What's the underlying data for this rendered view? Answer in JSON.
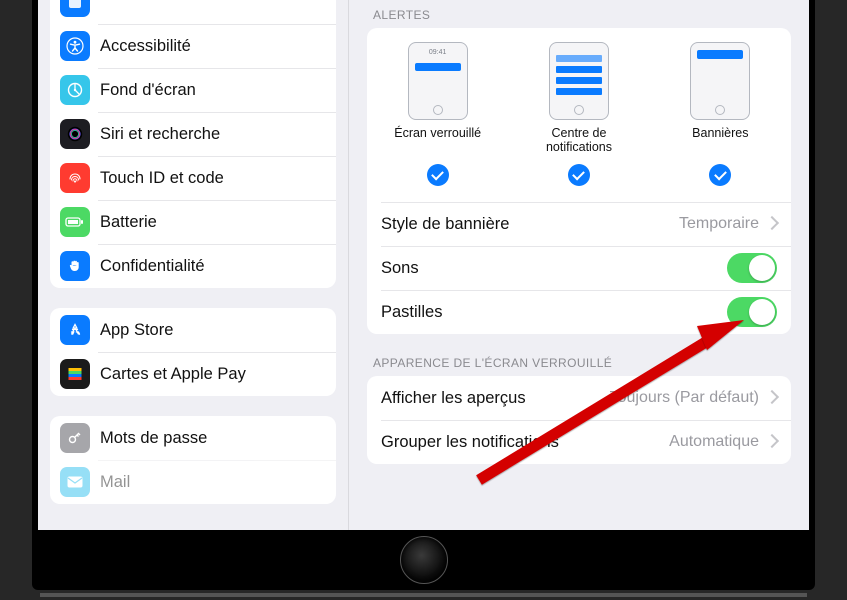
{
  "sidebar": {
    "group1": [
      {
        "label": "",
        "bg": "#0a7bff"
      },
      {
        "label": "Accessibilité",
        "bg": "#0a7bff",
        "icon": "accessibility"
      },
      {
        "label": "Fond d'écran",
        "bg": "#36c6ea",
        "icon": "wallpaper"
      },
      {
        "label": "Siri et recherche",
        "bg": "#2f2f35",
        "icon": "siri"
      },
      {
        "label": "Touch ID et code",
        "bg": "#ff3b30",
        "icon": "fingerprint"
      },
      {
        "label": "Batterie",
        "bg": "#4cd964",
        "icon": "battery"
      },
      {
        "label": "Confidentialité",
        "bg": "#0a7bff",
        "icon": "hand"
      }
    ],
    "group2": [
      {
        "label": "App Store",
        "bg": "#0a7bff",
        "icon": "appstore"
      },
      {
        "label": "Cartes et Apple Pay",
        "bg": "#1b1b1b",
        "icon": "wallet"
      }
    ],
    "group3": [
      {
        "label": "Mots de passe",
        "bg": "#a6a6aa",
        "icon": "key"
      },
      {
        "label": "Mail",
        "bg": "#18b8ea",
        "icon": "mail"
      }
    ]
  },
  "alerts": {
    "header": "ALERTES",
    "types": [
      {
        "label": "Écran verrouillé",
        "checked": true,
        "time": "09:41"
      },
      {
        "label": "Centre de notifications",
        "checked": true
      },
      {
        "label": "Bannières",
        "checked": true
      }
    ],
    "rows": {
      "banner_style": {
        "label": "Style de bannière",
        "value": "Temporaire"
      },
      "sounds": {
        "label": "Sons",
        "on": true
      },
      "badges": {
        "label": "Pastilles",
        "on": true
      }
    }
  },
  "lockscreen": {
    "header": "APPARENCE DE L'ÉCRAN VERROUILLÉ",
    "rows": {
      "previews": {
        "label": "Afficher les aperçus",
        "value": "Toujours (Par défaut)"
      },
      "grouping": {
        "label": "Grouper les notifications",
        "value": "Automatique"
      }
    }
  }
}
